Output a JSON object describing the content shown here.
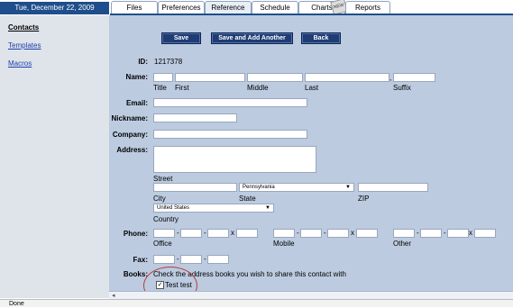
{
  "header": {
    "date": "Tue, December 22, 2009",
    "tabs": [
      {
        "label": "Files"
      },
      {
        "label": "Preferences"
      },
      {
        "label": "Reference",
        "active": true
      },
      {
        "label": "Schedule"
      },
      {
        "label": "Charts"
      },
      {
        "label": "Reports"
      }
    ],
    "charts_badge": "NEW"
  },
  "sidebar": {
    "items": [
      {
        "label": "Contacts"
      },
      {
        "label": "Templates"
      },
      {
        "label": "Macros"
      }
    ]
  },
  "toolbar": {
    "save_label": "Save",
    "save_add_label": "Save and Add Another",
    "back_label": "Back"
  },
  "form": {
    "id_label": "ID:",
    "id_value": "1217378",
    "name_label": "Name:",
    "name_sub": {
      "title": "Title",
      "first": "First",
      "middle": "Middle",
      "last": "Last",
      "suffix": "Suffix"
    },
    "name_comma": ",",
    "email_label": "Email:",
    "nickname_label": "Nickname:",
    "company_label": "Company:",
    "address_label": "Address:",
    "address_sub": {
      "street": "Street",
      "city": "City",
      "state": "State",
      "zip": "ZIP",
      "country": "Country"
    },
    "state_value": "Pennsylvania",
    "country_value": "United States",
    "phone_label": "Phone:",
    "phone_sub": {
      "office": "Office",
      "mobile": "Mobile",
      "other": "Other"
    },
    "phone_sep": "-",
    "phone_ext": "x",
    "fax_label": "Fax:",
    "books_label": "Books:",
    "books_text": "Check the address books you wish to share this contact with",
    "book_name": "Test test",
    "book_checked": "✓"
  },
  "status": {
    "text": "Done"
  }
}
